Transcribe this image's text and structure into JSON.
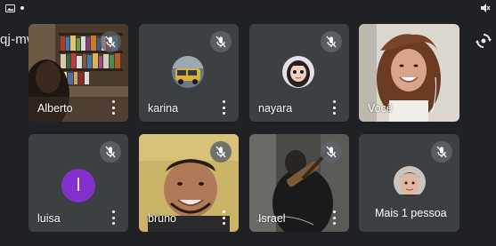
{
  "meeting": {
    "code": "qj-mwey-ahr"
  },
  "participants": [
    {
      "name": "Alberto",
      "muted": true,
      "video": true
    },
    {
      "name": "karina",
      "muted": true,
      "video": false
    },
    {
      "name": "nayara",
      "muted": true,
      "video": false
    },
    {
      "name": "Você",
      "muted": false,
      "video": true
    },
    {
      "name": "luisa",
      "muted": true,
      "video": false,
      "initial": "l"
    },
    {
      "name": "bruno",
      "muted": true,
      "video": true
    },
    {
      "name": "Israel",
      "muted": true,
      "video": true
    },
    {
      "label": "Mais 1 pessoa",
      "muted": true,
      "video": false
    }
  ],
  "colors": {
    "background": "#202124",
    "tile": "#3c4043",
    "luisa_avatar": "#8430ce"
  },
  "icons": {
    "flip_camera": "flip-camera-icon",
    "mic_off": "mic-off-icon",
    "more": "more-vert-icon"
  }
}
